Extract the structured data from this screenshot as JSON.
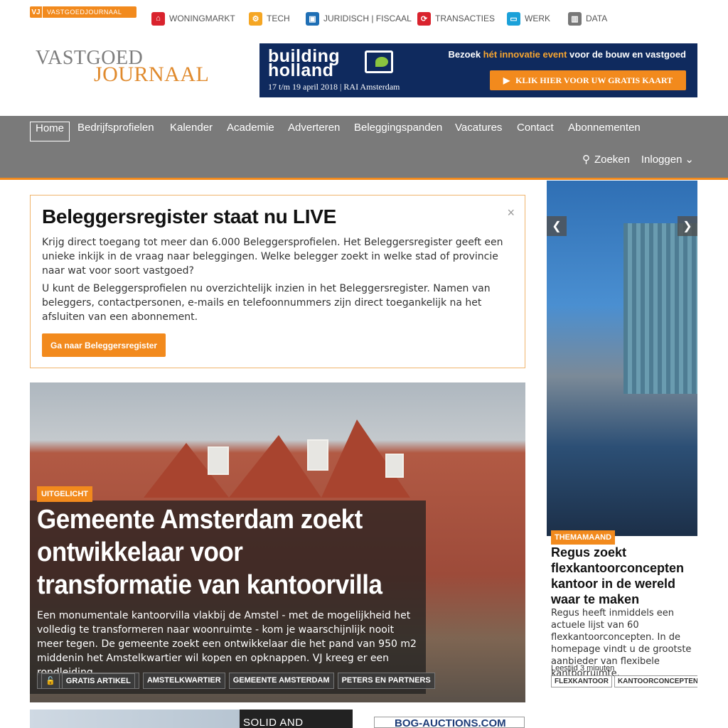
{
  "topbar": {
    "vj_badge": "VJ",
    "vj_label": "VASTGOEDJOURNAAL",
    "categories": [
      {
        "label": "WONINGMARKT",
        "icon": "house-icon",
        "color": "#d9232d"
      },
      {
        "label": "TECH",
        "icon": "gear-icon",
        "color": "#f5a623"
      },
      {
        "label": "JURIDISCH | FISCAAL",
        "icon": "wallet-icon",
        "color": "#1f6fb5"
      },
      {
        "label": "TRANSACTIES",
        "icon": "refresh-icon",
        "color": "#d9232d"
      },
      {
        "label": "WERK",
        "icon": "monitor-icon",
        "color": "#1ba1d9"
      },
      {
        "label": "DATA",
        "icon": "bar-chart-icon",
        "color": "#777777"
      }
    ]
  },
  "logo": {
    "line1": "VASTGOED",
    "line2": "JOURNAAL"
  },
  "banner": {
    "brand": "building holland",
    "tagline_pre": "Bezoek ",
    "tagline_em": "hét innovatie event",
    "tagline_post": " voor de bouw en vastgoed",
    "dates": "17 t/m 19 april 2018  |  RAI Amsterdam",
    "cta": "KLIK HIER VOOR UW GRATIS KAART"
  },
  "nav": {
    "items": [
      "Home",
      "Bedrijfsprofielen",
      "Kalender",
      "Academie",
      "Adverteren",
      "Beleggingspanden",
      "Vacatures",
      "Contact",
      "Abonnementen"
    ],
    "search": "Zoeken",
    "login": "Inloggen"
  },
  "notice": {
    "title": "Beleggersregister staat nu LIVE",
    "p1": "Krijg direct toegang tot meer dan 6.000 Beleggersprofielen. Het Beleggersregister geeft een unieke inkijk in de vraag naar beleggingen. Welke belegger zoekt in welke stad of provincie naar wat voor soort vastgoed?",
    "p2": "U kunt de Beleggersprofielen nu overzichtelijk inzien in het Beleggersregister. Namen van beleggers, contactpersonen, e-mails en telefoonnummers zijn direct toegankelijk na het afsluiten van een abonnement.",
    "button": "Ga naar Beleggersregister",
    "close": "×"
  },
  "hero": {
    "tag": "UITGELICHT",
    "title": "Gemeente Amsterdam zoekt ontwikkelaar voor transformatie van kantoorvilla",
    "lead": "Een monumentale kantoorvilla vlakbij de Amstel - met de mogelijkheid het volledig te transformeren naar woonruimte - kom je waarschijnlijk nooit meer tegen. De gemeente zoekt een ontwikkelaar die het pand van 950 m2 middenin het Amstelkwartier wil kopen en opknappen. VJ kreeg er een rondleiding.",
    "tags": [
      "GRATIS ARTIKEL",
      "AMSTELKWARTIER",
      "GEMEENTE AMSTERDAM",
      "PETERS EN PARTNERS"
    ]
  },
  "slider": {
    "tag": "THEMAMAAND",
    "title": "Regus zoekt flexkantoorconcepten kantoor in de wereld waar te maken",
    "text": "Regus heeft inmiddels een actuele lijst van 60 flexkantoorconcepten. In de homepage vindt u de grootste aanbieder van flexibele kantoorruimte.",
    "meta": "Leestijd 3 minuten",
    "tags": [
      "FLEXKANTOOR",
      "KANTOORCONCEPTEN"
    ]
  },
  "teasers": {
    "t1": "SOLID AND INSPIRED",
    "t2": "BOG-AUCTIONS.COM"
  }
}
